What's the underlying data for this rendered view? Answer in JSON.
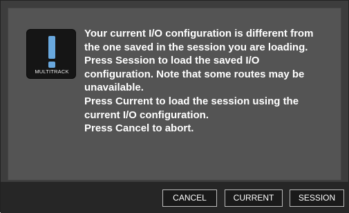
{
  "dialog": {
    "icon": {
      "name": "exclamation-icon",
      "caption": "MULTITRACK",
      "accent_color": "#69a8de"
    },
    "message_lines": [
      "Your current I/O configuration is different from",
      "the one saved in the session you are loading.",
      "Press Session to load the saved I/O",
      "configuration. Note that some routes may be",
      "unavailable.",
      "Press Current to load the session using the",
      "current I/O configuration.",
      "Press Cancel to abort."
    ],
    "buttons": {
      "cancel": "CANCEL",
      "current": "CURRENT",
      "session": "SESSION"
    }
  }
}
